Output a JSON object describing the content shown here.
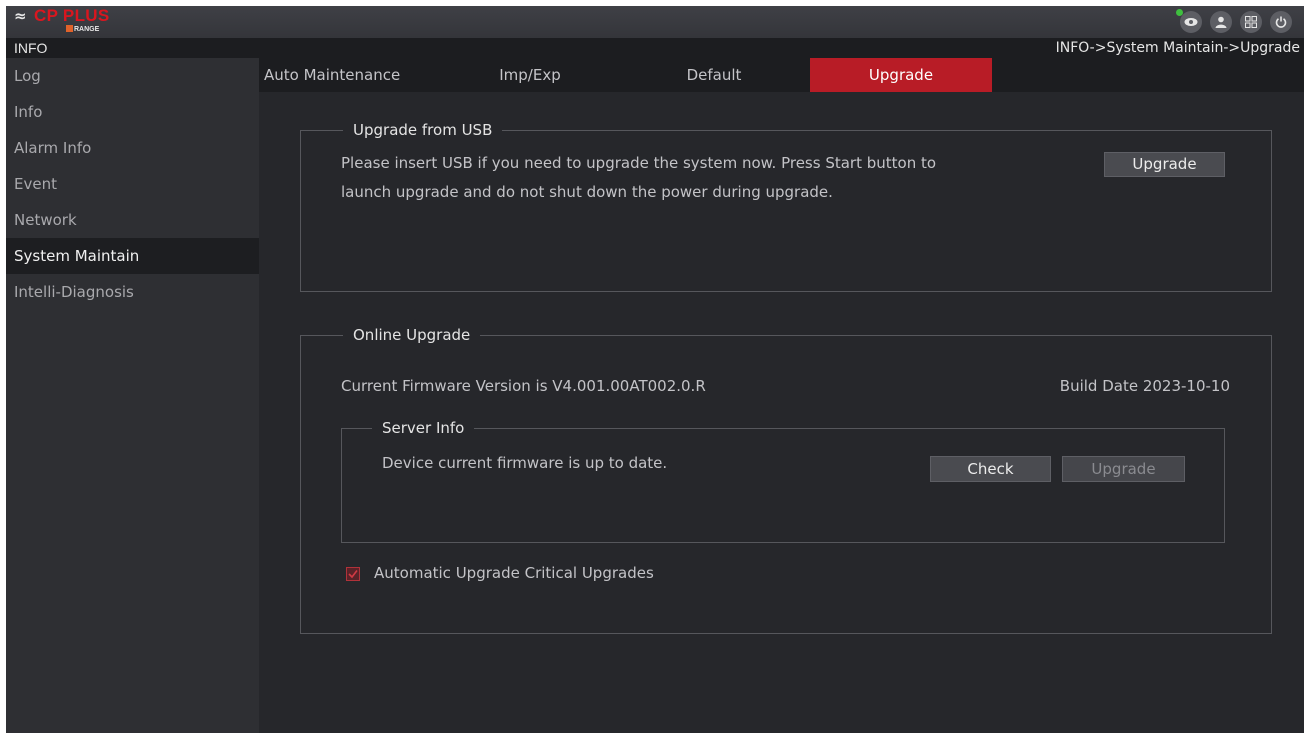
{
  "app": {
    "logo_text": "CP PLUS",
    "logo_sub": "RANGE",
    "brand_color": "#d9161f",
    "accent_color": "#b81c26"
  },
  "top_icons": [
    {
      "name": "live-view-icon"
    },
    {
      "name": "user-icon"
    },
    {
      "name": "grid-menu-icon"
    },
    {
      "name": "power-icon"
    }
  ],
  "header": {
    "title": "INFO",
    "breadcrumb": "INFO->System Maintain->Upgrade"
  },
  "sidebar": {
    "items": [
      {
        "label": "Log",
        "active": false
      },
      {
        "label": "Info",
        "active": false
      },
      {
        "label": "Alarm Info",
        "active": false
      },
      {
        "label": "Event",
        "active": false
      },
      {
        "label": "Network",
        "active": false
      },
      {
        "label": "System Maintain",
        "active": true
      },
      {
        "label": "Intelli-Diagnosis",
        "active": false
      }
    ]
  },
  "tabs": [
    {
      "label": "Auto Maintenance",
      "active": false
    },
    {
      "label": "Imp/Exp",
      "active": false
    },
    {
      "label": "Default",
      "active": false
    },
    {
      "label": "Upgrade",
      "active": true
    }
  ],
  "usb_upgrade": {
    "legend": "Upgrade from USB",
    "line1": "Please insert USB if you need to upgrade the system now. Press Start button to",
    "line2": "launch upgrade and do not shut down the power during upgrade.",
    "button_label": "Upgrade"
  },
  "online_upgrade": {
    "legend": "Online Upgrade",
    "firmware_text": "Current Firmware Version is V4.001.00AT002.0.R",
    "build_date": "Build Date 2023-10-10",
    "server_info": {
      "legend": "Server Info",
      "status_text": "Device current firmware is up to date.",
      "check_label": "Check",
      "upgrade_label": "Upgrade",
      "upgrade_disabled": true
    },
    "auto_upgrade_label": "Automatic Upgrade Critical Upgrades",
    "auto_upgrade_checked": true
  }
}
